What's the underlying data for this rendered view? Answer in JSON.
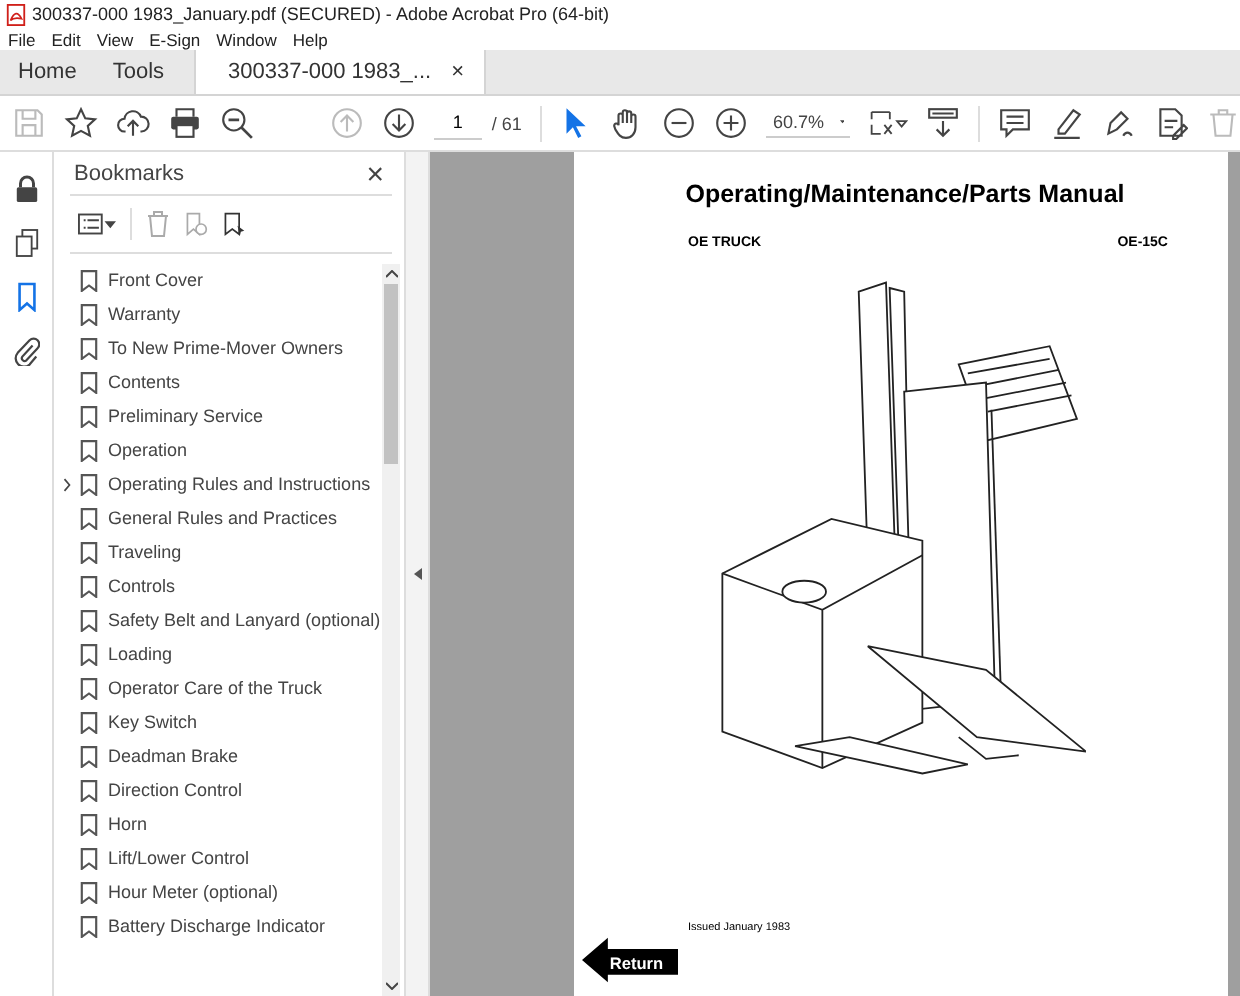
{
  "window": {
    "title": "300337-000 1983_January.pdf (SECURED) - Adobe Acrobat Pro (64-bit)"
  },
  "menu": [
    "File",
    "Edit",
    "View",
    "E-Sign",
    "Window",
    "Help"
  ],
  "tabs": [
    {
      "label": "Home",
      "selected": false,
      "closable": false
    },
    {
      "label": "Tools",
      "selected": false,
      "closable": false
    },
    {
      "label": "300337-000 1983_...",
      "selected": true,
      "closable": true
    }
  ],
  "close_glyph": "×",
  "toolbar": {
    "page": "1",
    "page_total": "/ 61",
    "zoom": "60.7%"
  },
  "bookmarks": {
    "title": "Bookmarks",
    "close_glyph": "×",
    "items": [
      {
        "label": "Front Cover",
        "kind": "leaf"
      },
      {
        "label": "Warranty",
        "kind": "leaf"
      },
      {
        "label": "To New Prime-Mover Owners",
        "kind": "leaf"
      },
      {
        "label": "Contents",
        "kind": "leaf"
      },
      {
        "label": "Preliminary Service",
        "kind": "leaf"
      },
      {
        "label": "Operation",
        "kind": "leaf"
      },
      {
        "label": "Operating Rules and Instructions",
        "kind": "folder",
        "expanded": false
      },
      {
        "label": "General Rules and Practices",
        "kind": "leaf"
      },
      {
        "label": "Traveling",
        "kind": "leaf"
      },
      {
        "label": "Controls",
        "kind": "leaf"
      },
      {
        "label": "Safety Belt and Lanyard (optional)",
        "kind": "leaf"
      },
      {
        "label": "Loading",
        "kind": "leaf"
      },
      {
        "label": "Operator Care of the Truck",
        "kind": "leaf"
      },
      {
        "label": "Key Switch",
        "kind": "leaf"
      },
      {
        "label": "Deadman Brake",
        "kind": "leaf"
      },
      {
        "label": "Direction Control",
        "kind": "leaf"
      },
      {
        "label": "Horn",
        "kind": "leaf"
      },
      {
        "label": "Lift/Lower Control",
        "kind": "leaf"
      },
      {
        "label": "Hour Meter (optional)",
        "kind": "leaf"
      },
      {
        "label": "Battery Discharge Indicator",
        "kind": "leaf"
      }
    ]
  },
  "document": {
    "title": "Operating/Maintenance/Parts Manual",
    "subtitle_left": "OE TRUCK",
    "subtitle_right": "OE-15C",
    "issued": "Issued January 1983",
    "return_label": "Return"
  }
}
